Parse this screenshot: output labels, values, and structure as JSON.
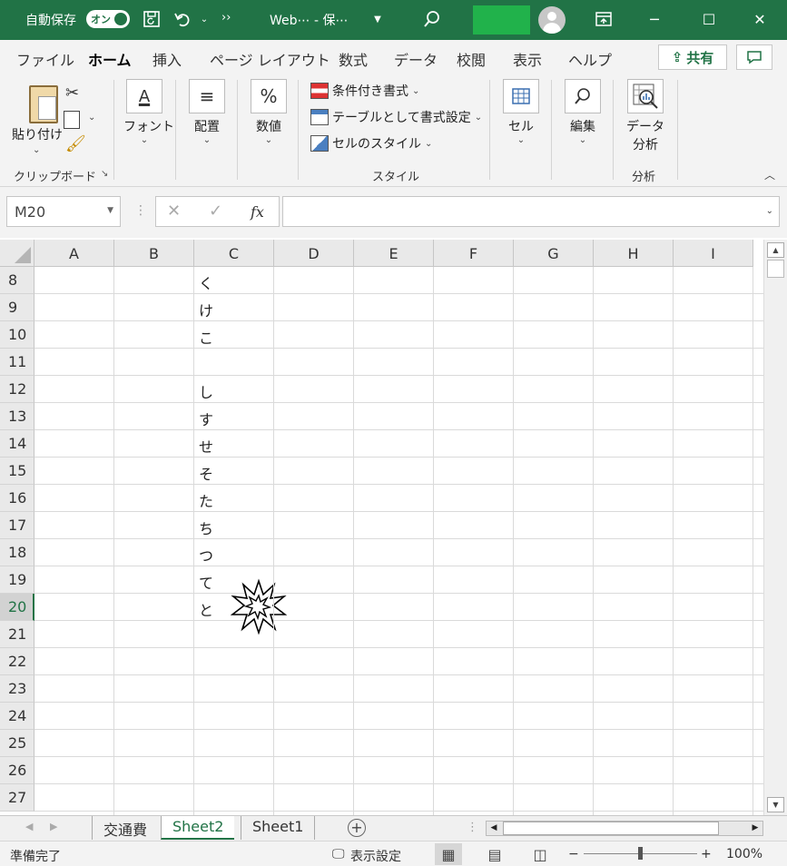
{
  "titlebar": {
    "autosave_label": "自動保存",
    "autosave_state": "オン",
    "document_title": "Web⋯ - 保⋯ ",
    "more": "››",
    "minimize": "─",
    "maximize": "☐",
    "close": "✕"
  },
  "tabs": {
    "items": [
      "ファイル",
      "ホーム",
      "挿入",
      "ページ レイアウト",
      "数式",
      "データ",
      "校閲",
      "表示",
      "ヘルプ"
    ],
    "active": "ホーム",
    "share_label": "共有"
  },
  "ribbon": {
    "clipboard": {
      "paste": "貼り付け",
      "group": "クリップボード"
    },
    "font": {
      "label": "フォント"
    },
    "alignment": {
      "label": "配置"
    },
    "number": {
      "label": "数値",
      "icon_text": "%"
    },
    "styles": {
      "conditional": "条件付き書式",
      "table": "テーブルとして書式設定",
      "cell_styles": "セルのスタイル",
      "group": "スタイル"
    },
    "cells": {
      "label": "セル"
    },
    "editing": {
      "label": "編集"
    },
    "analysis": {
      "label1": "データ",
      "label2": "分析",
      "group": "分析"
    }
  },
  "formula_bar": {
    "name_box": "M20",
    "fx": "fx",
    "cancel": "✕",
    "enter": "✓",
    "formula": ""
  },
  "grid": {
    "columns": [
      "A",
      "B",
      "C",
      "D",
      "E",
      "F",
      "G",
      "H",
      "I"
    ],
    "rows": [
      {
        "num": "8",
        "c": "く"
      },
      {
        "num": "9",
        "c": "け"
      },
      {
        "num": "10",
        "c": "こ"
      },
      {
        "num": "11",
        "c": ""
      },
      {
        "num": "12",
        "c": "し"
      },
      {
        "num": "13",
        "c": "す"
      },
      {
        "num": "14",
        "c": "せ"
      },
      {
        "num": "15",
        "c": "そ"
      },
      {
        "num": "16",
        "c": "た"
      },
      {
        "num": "17",
        "c": "ち"
      },
      {
        "num": "18",
        "c": "つ"
      },
      {
        "num": "19",
        "c": "て"
      },
      {
        "num": "20",
        "c": "と"
      },
      {
        "num": "21",
        "c": ""
      },
      {
        "num": "22",
        "c": ""
      },
      {
        "num": "23",
        "c": ""
      },
      {
        "num": "24",
        "c": ""
      },
      {
        "num": "25",
        "c": ""
      },
      {
        "num": "26",
        "c": ""
      },
      {
        "num": "27",
        "c": ""
      }
    ],
    "selected_row": "20"
  },
  "sheets": {
    "tabs": [
      "交通費",
      "Sheet2",
      "Sheet1"
    ],
    "active": "Sheet2"
  },
  "status": {
    "ready": "準備完了",
    "display_settings": "表示設定",
    "zoom": "100%",
    "zoom_level_percent": 100
  }
}
